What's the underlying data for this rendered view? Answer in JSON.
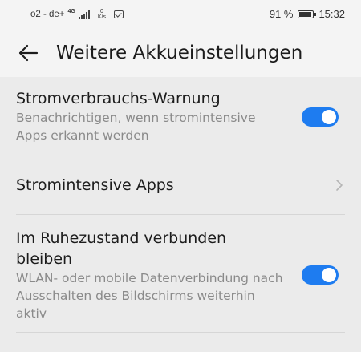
{
  "status_bar": {
    "carrier": "o2 - de+",
    "network": "4G",
    "speed_value": "0",
    "speed_unit": "K/s",
    "battery": "91 %",
    "time": "15:32"
  },
  "header": {
    "title": "Weitere Akkueinstellungen"
  },
  "settings": [
    {
      "title": "Stromverbrauchs-Warnung",
      "subtitle": "Benachrichtigen, wenn stromintensive Apps erkannt werden",
      "control": "toggle",
      "enabled": true
    },
    {
      "title": "Stromintensive Apps",
      "control": "chevron"
    },
    {
      "title": "Im Ruhezustand verbunden bleiben",
      "subtitle": "WLAN- oder mobile Datenverbindung nach Ausschalten des Bildschirms weiterhin aktiv",
      "control": "toggle",
      "enabled": true
    }
  ],
  "colors": {
    "toggle_on": "#1e7cf0",
    "background": "#ebebeb",
    "subtitle": "#8a8a8a"
  }
}
